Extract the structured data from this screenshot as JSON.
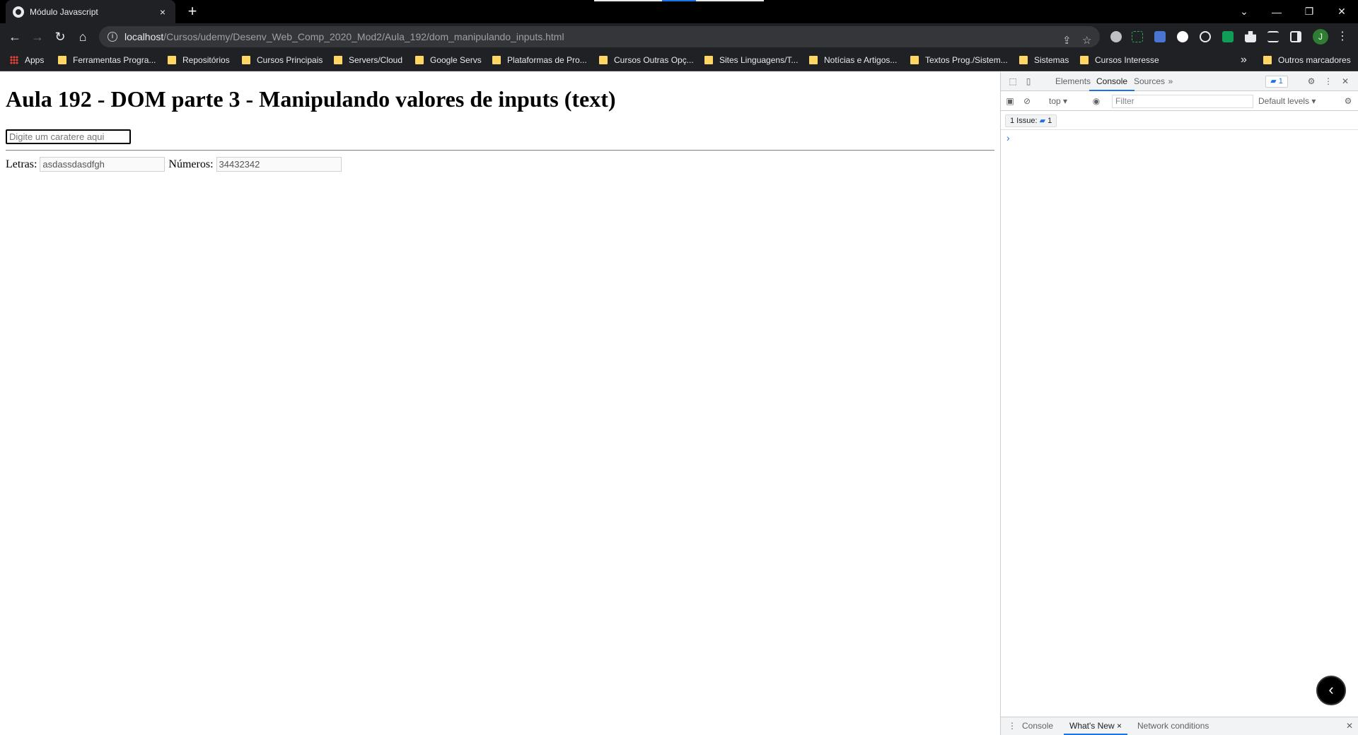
{
  "browser": {
    "tab": {
      "title": "Módulo Javascript",
      "close": "×"
    },
    "new_tab": "+",
    "window_controls": {
      "minimize": "—",
      "restore": "❐",
      "close": "✕",
      "tab_search": "⌄"
    },
    "nav": {
      "back": "←",
      "forward": "→",
      "reload": "↻",
      "home": "⌂"
    },
    "url": {
      "host": "localhost",
      "path": "/Cursos/udemy/Desenv_Web_Comp_2020_Mod2/Aula_192/dom_manipulando_inputs.html"
    },
    "avatar_initial": "J",
    "bookmarks": [
      {
        "label": "Apps",
        "icon": "apps-grid-icon"
      },
      {
        "label": "Ferramentas Progra...",
        "icon": "folder-icon"
      },
      {
        "label": "Repositórios",
        "icon": "folder-icon"
      },
      {
        "label": "Cursos Principais",
        "icon": "folder-icon"
      },
      {
        "label": "Servers/Cloud",
        "icon": "folder-icon"
      },
      {
        "label": "Google Servs",
        "icon": "folder-icon"
      },
      {
        "label": "Plataformas de Pro...",
        "icon": "folder-icon"
      },
      {
        "label": "Cursos Outras Opç...",
        "icon": "folder-icon"
      },
      {
        "label": "Sites Linguagens/T...",
        "icon": "folder-icon"
      },
      {
        "label": "Notícias e Artigos...",
        "icon": "folder-icon"
      },
      {
        "label": "Textos Prog./Sistem...",
        "icon": "folder-icon"
      },
      {
        "label": "Sistemas",
        "icon": "folder-icon"
      },
      {
        "label": "Cursos Interesse",
        "icon": "folder-icon"
      }
    ],
    "bookmarks_more": "»",
    "other_bookmarks": "Outros marcadores"
  },
  "page": {
    "heading": "Aula 192 - DOM parte 3 - Manipulando valores de inputs (text)",
    "char_input_placeholder": "Digite um caratere aqui",
    "letters_label": "Letras:",
    "letters_value": "asdassdasdfgh",
    "numbers_label": "Números:",
    "numbers_value": "34432342"
  },
  "devtools": {
    "tabs": [
      "Elements",
      "Console",
      "Sources"
    ],
    "active_tab": "Console",
    "more_tabs": "»",
    "issues_badge": "1",
    "context": "top ▾",
    "filter_placeholder": "Filter",
    "levels": "Default levels ▾",
    "issues_pill": "1 Issue:",
    "issues_count": "1",
    "prompt": "›",
    "drawer_tabs": [
      "Console",
      "What's New",
      "Network conditions"
    ],
    "drawer_active": "What's New",
    "drawer_close": "✕",
    "whatsnew_close": "×"
  }
}
